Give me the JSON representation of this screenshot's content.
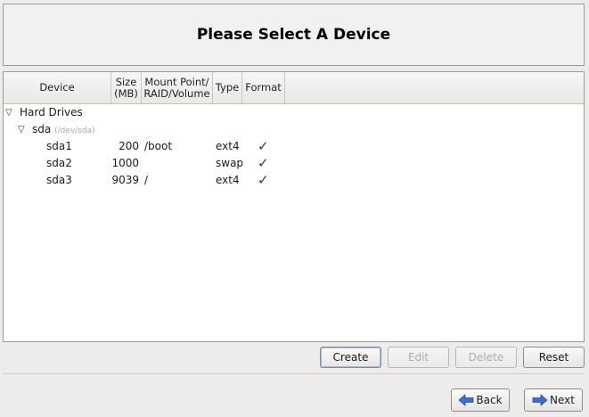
{
  "header": {
    "title": "Please Select A Device"
  },
  "columns": [
    {
      "label": "Device"
    },
    {
      "label": "Size\n(MB)"
    },
    {
      "label": "Mount Point/\nRAID/Volume"
    },
    {
      "label": "Type"
    },
    {
      "label": "Format"
    }
  ],
  "tree": {
    "group_label": "Hard Drives",
    "disk": {
      "name": "sda",
      "path": "(/dev/sda)"
    },
    "partitions": [
      {
        "device": "sda1",
        "size": "200",
        "mount": "/boot",
        "type": "ext4",
        "format": "✓"
      },
      {
        "device": "sda2",
        "size": "1000",
        "mount": "",
        "type": "swap",
        "format": "✓"
      },
      {
        "device": "sda3",
        "size": "9039",
        "mount": "/",
        "type": "ext4",
        "format": "✓"
      }
    ]
  },
  "actions": {
    "create": "Create",
    "edit": "Edit",
    "delete": "Delete",
    "reset": "Reset"
  },
  "nav": {
    "back": "Back",
    "next": "Next"
  },
  "colors": {
    "arrow_blue": "#3a6fd0",
    "window_bg": "#edeceb"
  },
  "icons": {
    "expander": "triangle-down-icon",
    "format_check": "check-icon",
    "back": "arrow-left-icon",
    "next": "arrow-right-icon"
  }
}
